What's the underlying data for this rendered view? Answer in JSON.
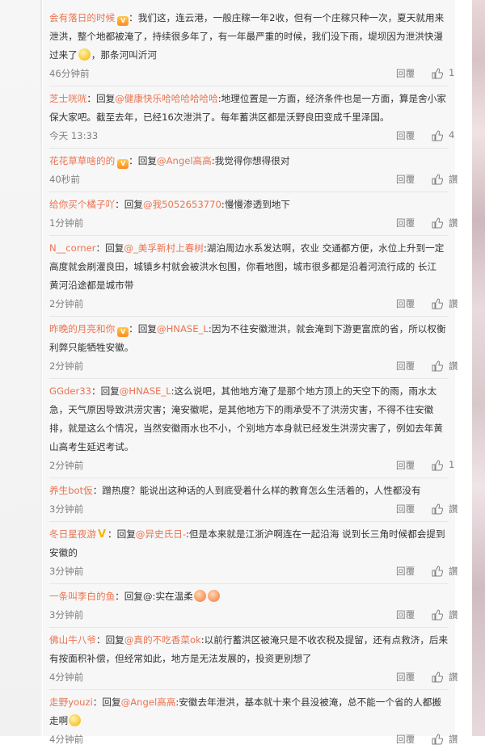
{
  "comments": [
    {
      "user": "会有落日的时候",
      "badge": "vip",
      "text_lines": [
        "：我们这，连云港，一般庄稼一年2收，但有一个庄稼只种一次，夏天就",
        "用来泄洪，整个地都被淹了，持续很多年了，有一年最严重的时候，我们没下雨，堤坝因为泄",
        "洪快漫过来了",
        "，那条河叫沂河"
      ],
      "time": "46分钟前",
      "reply_label": "回覆",
      "likes": "1"
    },
    {
      "user": "芝士咣咣",
      "reply_prefix": "：回复",
      "mention": "@健康快乐哈哈哈哈哈哈",
      "text_lines": [
        ":地理位置是一方面，经济条件也是一方面，算是舍小",
        "家保大家吧。截至去年，已经16次泄洪了。每年蓄洪区都是沃野良田变成千里泽国。"
      ],
      "time": "今天 13:33",
      "reply_label": "回覆",
      "likes": "4"
    },
    {
      "user": "花花草草啥的的",
      "badge": "vip",
      "reply_prefix": "：回复",
      "mention": "@Angel高高",
      "text_lines": [
        ":我觉得你想得很对"
      ],
      "time": "40秒前",
      "reply_label": "回覆",
      "likes": "讚"
    },
    {
      "user": "给你买个橘子吖",
      "reply_prefix": "：回复",
      "mention": "@我5052653770",
      "text_lines": [
        ":慢慢渗透到地下"
      ],
      "time": "1分钟前",
      "reply_label": "回覆",
      "likes": "讚"
    },
    {
      "user": "N__corner",
      "reply_prefix": "：回复",
      "mention": "@_美孚新村上春树",
      "text_lines": [
        ":湖泊周边水系发达啊，农业 交通都方便，水位上升到一",
        "定高度就会刷灌良田，城镇乡村就会被洪水包围，你看地图，城市很多都是沿着河流行成",
        "的  长江 黄河沿途都是城市带"
      ],
      "time": "2分钟前",
      "reply_label": "回覆",
      "likes": "讚"
    },
    {
      "user": "昨晚的月亮和你",
      "badge": "vip",
      "reply_prefix": "：回复",
      "mention": "@HNASE_L",
      "text_lines": [
        ":因为不往安徽泄洪，就会淹到下游更富庶的省，所以",
        "权衡利弊只能牺牲安徽。"
      ],
      "time": "2分钟前",
      "reply_label": "回覆",
      "likes": "讚"
    },
    {
      "user": "GGder33",
      "reply_prefix": "：回复",
      "mention": "@HNASE_L",
      "text_lines": [
        ":这么说吧，其他地方淹了是那个地方顶上的天空下的雨，雨水太",
        "急，天气原因导致洪涝灾害；淹安徽呢，是其他地方下的雨承受不了洪涝灾害，不得不往安徽",
        "排，就是这么个情况，当然安徽雨水也不小，个别地方本身就已经发生洪涝灾害了，例如去年",
        "黄山高考生延迟考试。"
      ],
      "time": "2分钟前",
      "reply_label": "回覆",
      "likes": "1"
    },
    {
      "user": "养生bot仮",
      "text_lines": [
        "：蹭热度？能说出这种话的人到底受着什么样的教育怎么生活着的，人性都没有"
      ],
      "time": "3分钟前",
      "reply_label": "回覆",
      "likes": "讚"
    },
    {
      "user": "冬日星夜游",
      "badge": "V",
      "reply_prefix": "：回复",
      "mention": "@异史氏日-",
      "text_lines": [
        ":但是本来就是江浙沪啊连在一起沿海 说到长三角时候都会提",
        "到安徽的"
      ],
      "time": "3分钟前",
      "reply_label": "回覆",
      "likes": "讚"
    },
    {
      "user": "一条叫李白的鱼",
      "reply_prefix": "：回复@:实在温柔",
      "text_lines": [
        ""
      ],
      "time": "3分钟前",
      "reply_label": "回覆",
      "likes": "讚"
    },
    {
      "user": "佛山牛八爷",
      "reply_prefix": "：回复",
      "mention": "@真的不吃香菜ok",
      "text_lines": [
        ":以前行蓄洪区被淹只是不收农税及提留，还有点救济，",
        "后来有按面积补偿，但经常如此，地方是无法发展的，投资更别想了"
      ],
      "time": "4分钟前",
      "reply_label": "回覆",
      "likes": "讚"
    },
    {
      "user": "走野youzi",
      "reply_prefix": "：回复",
      "mention": "@Angel高高",
      "text_lines": [
        ":安徽去年泄洪，基本就十来个县没被淹，总不能一个省的人都搬",
        "走啊"
      ],
      "time": "4分钟前",
      "reply_label": "回覆",
      "likes": "讚"
    }
  ]
}
